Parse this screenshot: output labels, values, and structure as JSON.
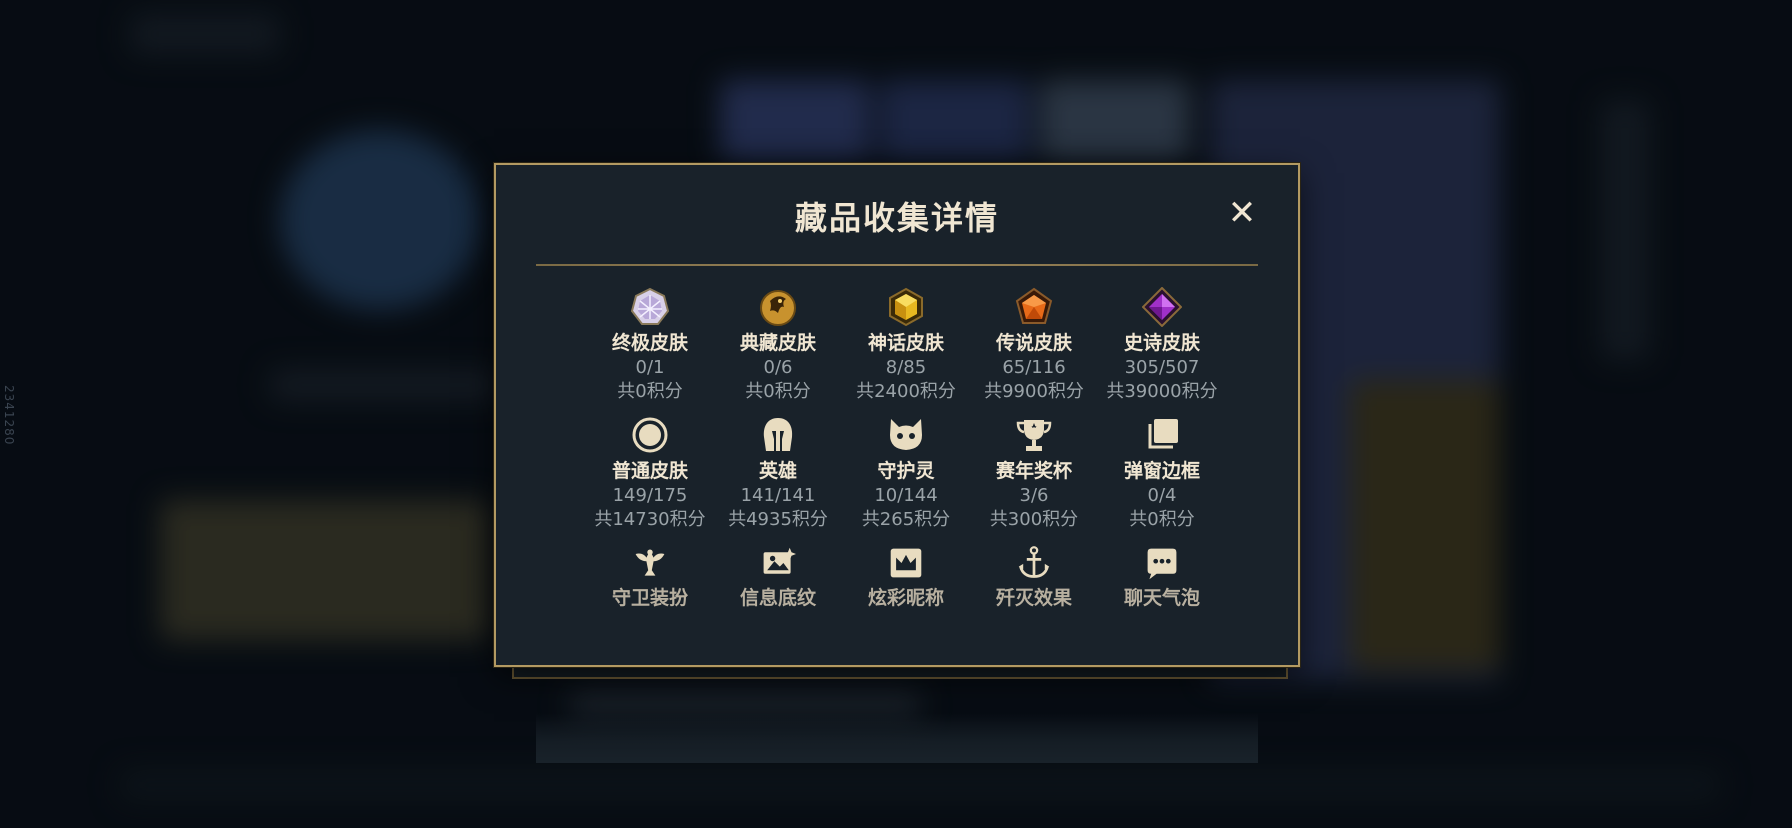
{
  "side_id": "2341280",
  "modal": {
    "title": "藏品收集详情",
    "close_label": "✕"
  },
  "colors": {
    "gold": "#b39a62",
    "title_text": "#f0e6d2",
    "muted_text": "#9aa3a8",
    "panel_bg": "#19222a"
  },
  "rows": [
    [
      {
        "icon": "ultimate-skin-gem-icon",
        "label": "终极皮肤",
        "count": "0/1",
        "points": "共0积分"
      },
      {
        "icon": "treasured-skin-dragon-icon",
        "label": "典藏皮肤",
        "count": "0/6",
        "points": "共0积分"
      },
      {
        "icon": "mythic-skin-gem-icon",
        "label": "神话皮肤",
        "count": "8/85",
        "points": "共2400积分"
      },
      {
        "icon": "legendary-skin-gem-icon",
        "label": "传说皮肤",
        "count": "65/116",
        "points": "共9900积分"
      },
      {
        "icon": "epic-skin-gem-icon",
        "label": "史诗皮肤",
        "count": "305/507",
        "points": "共39000积分"
      }
    ],
    [
      {
        "icon": "common-skin-circle-icon",
        "label": "普通皮肤",
        "count": "149/175",
        "points": "共14730积分"
      },
      {
        "icon": "champion-helmet-icon",
        "label": "英雄",
        "count": "141/141",
        "points": "共4935积分"
      },
      {
        "icon": "guardian-cat-icon",
        "label": "守护灵",
        "count": "10/144",
        "points": "共265积分"
      },
      {
        "icon": "season-trophy-icon",
        "label": "赛年奖杯",
        "count": "3/6",
        "points": "共300积分"
      },
      {
        "icon": "popup-frame-icon",
        "label": "弹窗边框",
        "count": "0/4",
        "points": "共0积分"
      }
    ],
    [
      {
        "icon": "ward-skin-icon",
        "label": "守卫装扮"
      },
      {
        "icon": "profile-banner-icon",
        "label": "信息底纹"
      },
      {
        "icon": "colored-nickname-crown-icon",
        "label": "炫彩昵称"
      },
      {
        "icon": "annihilation-effect-anchor-icon",
        "label": "歼灭效果"
      },
      {
        "icon": "chat-bubble-icon",
        "label": "聊天气泡"
      }
    ]
  ]
}
